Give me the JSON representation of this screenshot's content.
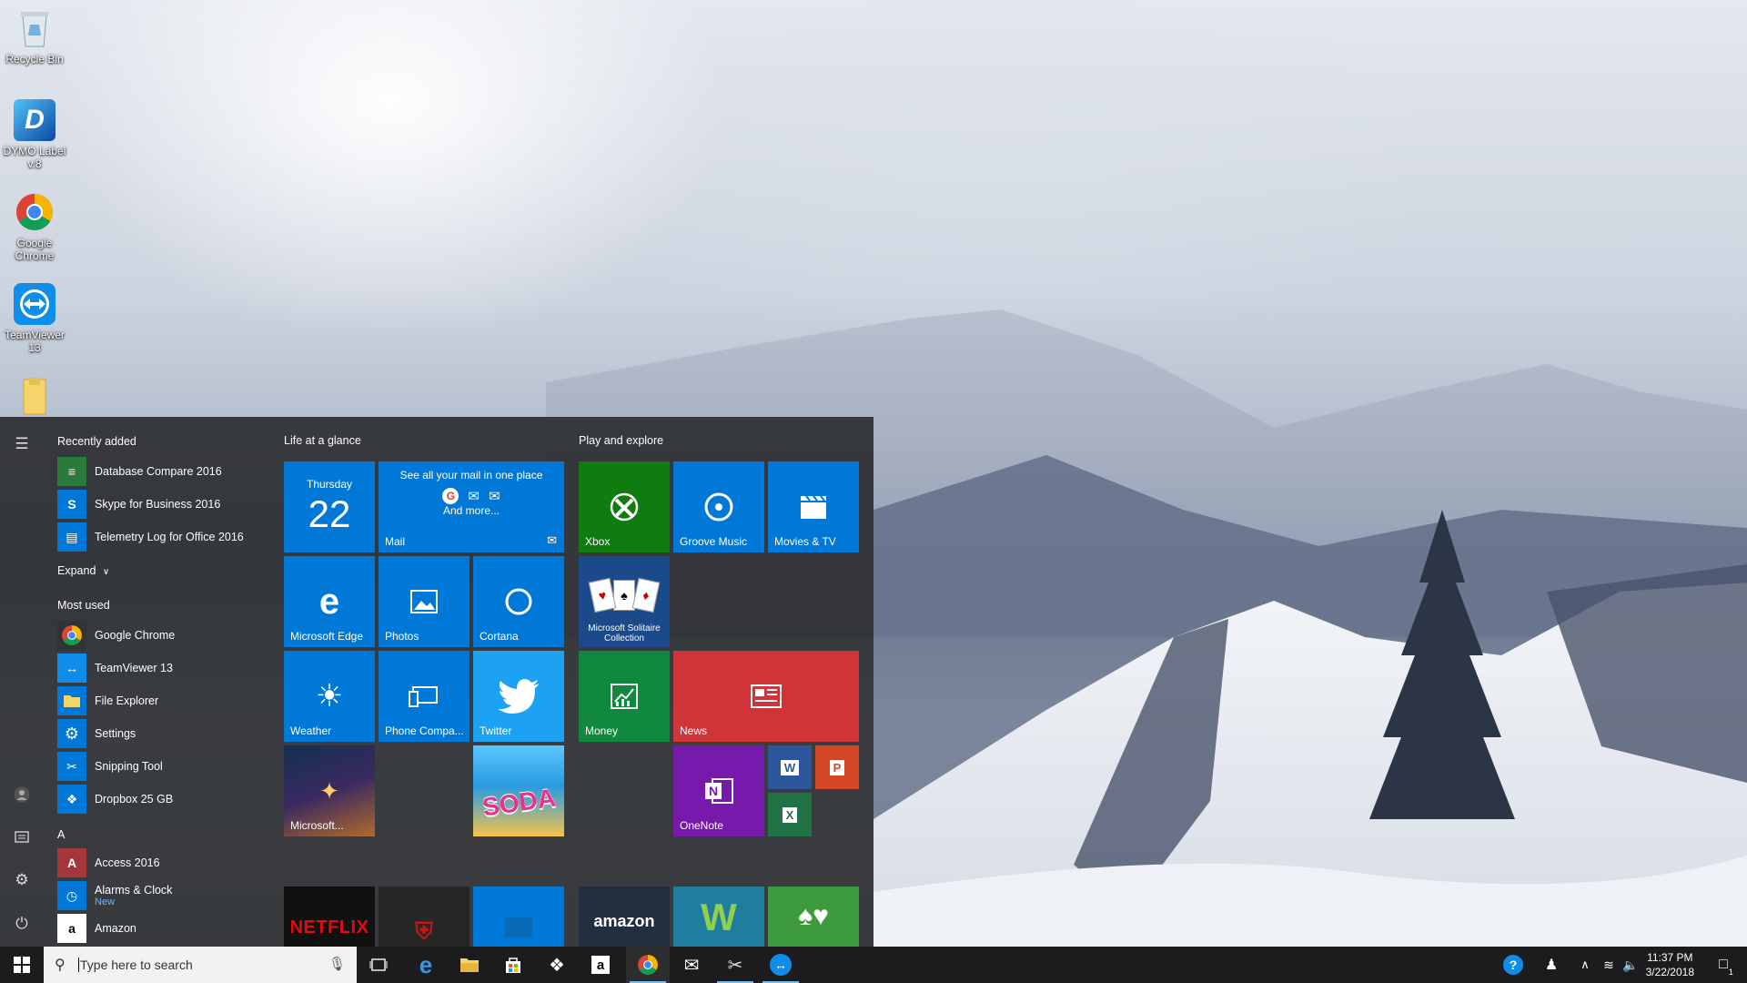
{
  "desktop": {
    "icons": [
      {
        "label": "Recycle Bin",
        "icon": "recycle-bin-icon"
      },
      {
        "label": "DYMO Label v.8",
        "icon": "dymo-icon"
      },
      {
        "label": "Google Chrome",
        "icon": "chrome-icon"
      },
      {
        "label": "TeamViewer 13",
        "icon": "teamviewer-icon"
      },
      {
        "label": "",
        "icon": "folder-icon"
      }
    ]
  },
  "start_menu": {
    "recently_added": {
      "title": "Recently added",
      "items": [
        {
          "label": "Database Compare 2016"
        },
        {
          "label": "Skype for Business 2016"
        },
        {
          "label": "Telemetry Log for Office 2016"
        }
      ],
      "expand_label": "Expand"
    },
    "most_used": {
      "title": "Most used",
      "items": [
        {
          "label": "Google Chrome"
        },
        {
          "label": "TeamViewer 13"
        },
        {
          "label": "File Explorer"
        },
        {
          "label": "Settings"
        },
        {
          "label": "Snipping Tool"
        },
        {
          "label": "Dropbox 25 GB"
        }
      ]
    },
    "alpha": {
      "letter": "A",
      "items": [
        {
          "label": "Access 2016",
          "sub": ""
        },
        {
          "label": "Alarms & Clock",
          "sub": "New"
        },
        {
          "label": "Amazon",
          "sub": ""
        }
      ]
    },
    "life_group": {
      "title": "Life at a glance",
      "calendar": {
        "day": "Thursday",
        "date": "22"
      },
      "mail": {
        "headline": "See all your mail in one place",
        "more": "And more...",
        "label": "Mail"
      },
      "tiles": {
        "edge": "Microsoft Edge",
        "photos": "Photos",
        "cortana": "Cortana",
        "weather": "Weather",
        "phone": "Phone Compa...",
        "twitter": "Twitter",
        "game": "Microsoft..."
      },
      "candy_text": "SODA",
      "bottom": {
        "netflix": "NETFLIX"
      }
    },
    "play_group": {
      "title": "Play and explore",
      "tiles": {
        "xbox": "Xbox",
        "groove": "Groove Music",
        "movies": "Movies & TV",
        "solitaire": "Microsoft Solitaire Collection",
        "money": "Money",
        "news": "News",
        "onenote": "OneNote"
      },
      "bottom": {
        "amazon": "amazon"
      }
    }
  },
  "taskbar": {
    "search_placeholder": "Type here to search",
    "time": "11:37 PM",
    "date": "3/22/2018",
    "notification_count": "1"
  },
  "colors": {
    "tile_blue": "#0078d7",
    "xbox_green": "#107c10",
    "money_green": "#10893e",
    "news_red": "#d13438",
    "onenote_purple": "#7719aa",
    "twitter_blue": "#1da1f2"
  }
}
